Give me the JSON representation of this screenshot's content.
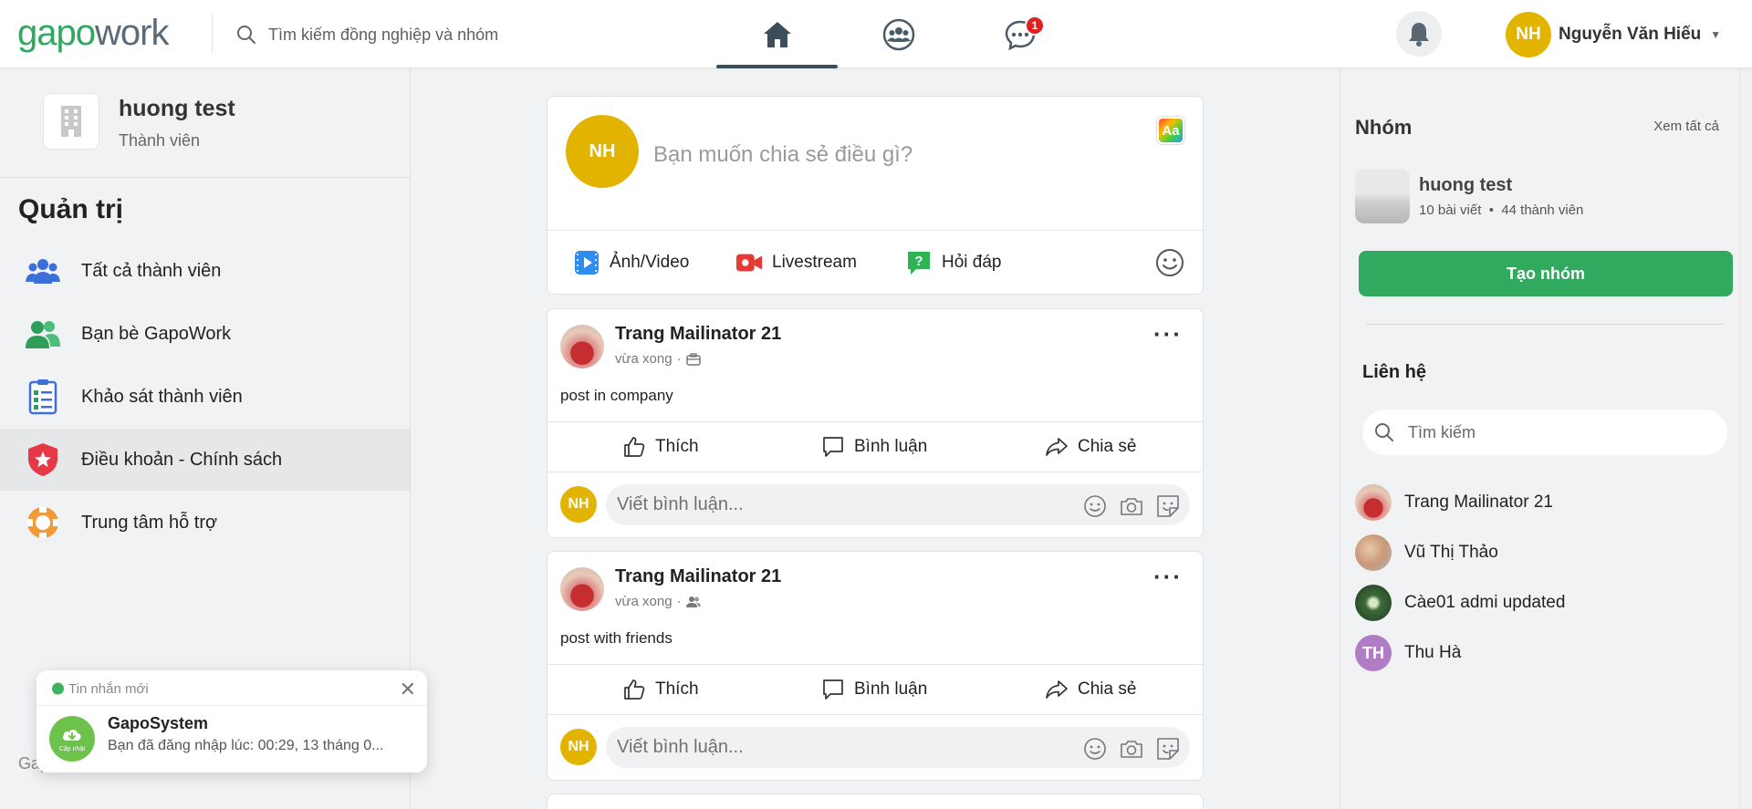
{
  "header": {
    "logo_gapo": "gapo",
    "logo_work": "work",
    "search_placeholder": "Tìm kiếm đồng nghiệp và nhóm",
    "chat_badge": "1",
    "user_initials": "NH",
    "user_name": "Nguyễn Văn Hiếu"
  },
  "colors": {
    "brand_green": "#30a860",
    "avatar_yellow": "#e2b400",
    "badge_red": "#e02020",
    "create_button": "#31a95e"
  },
  "sidebar": {
    "company_name": "huong test",
    "company_role": "Thành viên",
    "admin_title": "Quản trị",
    "items": [
      {
        "label": "Tất cả thành viên",
        "icon": "members-icon"
      },
      {
        "label": "Bạn bè GapoWork",
        "icon": "friends-icon"
      },
      {
        "label": "Khảo sát thành viên",
        "icon": "survey-icon"
      },
      {
        "label": "Điều khoản - Chính sách",
        "icon": "shield-icon"
      },
      {
        "label": "Trung tâm hỗ trợ",
        "icon": "lifebuoy-icon"
      }
    ],
    "footer": "Gapo"
  },
  "composer": {
    "initials": "NH",
    "placeholder": "Bạn muốn chia sẻ điều gì?",
    "font_button": "Aa",
    "actions": [
      "Ảnh/Video",
      "Livestream",
      "Hỏi đáp"
    ]
  },
  "posts": [
    {
      "author": "Trang Mailinator 21",
      "time": "vừa xong",
      "audience_icon": "company-icon",
      "text": "post in company",
      "actions": [
        "Thích",
        "Bình luận",
        "Chia sẻ"
      ],
      "comment_initials": "NH",
      "comment_placeholder": "Viết bình luận..."
    },
    {
      "author": "Trang Mailinator 21",
      "time": "vừa xong",
      "audience_icon": "friends-icon",
      "text": "post with friends",
      "actions": [
        "Thích",
        "Bình luận",
        "Chia sẻ"
      ],
      "comment_initials": "NH",
      "comment_placeholder": "Viết bình luận..."
    }
  ],
  "right": {
    "groups_title": "Nhóm",
    "see_all": "Xem tất cả",
    "group": {
      "name": "huong test",
      "posts": "10 bài viết",
      "members": "44 thành viên"
    },
    "create_group": "Tạo nhóm",
    "contacts_title": "Liên hệ",
    "contacts_search": "Tìm kiếm",
    "contacts": [
      {
        "name": "Trang Mailinator 21"
      },
      {
        "name": "Vũ Thị Thảo"
      },
      {
        "name": "Càe01 admi updated"
      },
      {
        "name": "Thu Hà",
        "initials": "TH"
      }
    ]
  },
  "toast": {
    "header": "Tin nhắn mới",
    "sender": "GapoSystem",
    "icon_label": "Cập nhật",
    "message": "Bạn đã đăng nhập lúc: 00:29, 13 tháng 0..."
  }
}
